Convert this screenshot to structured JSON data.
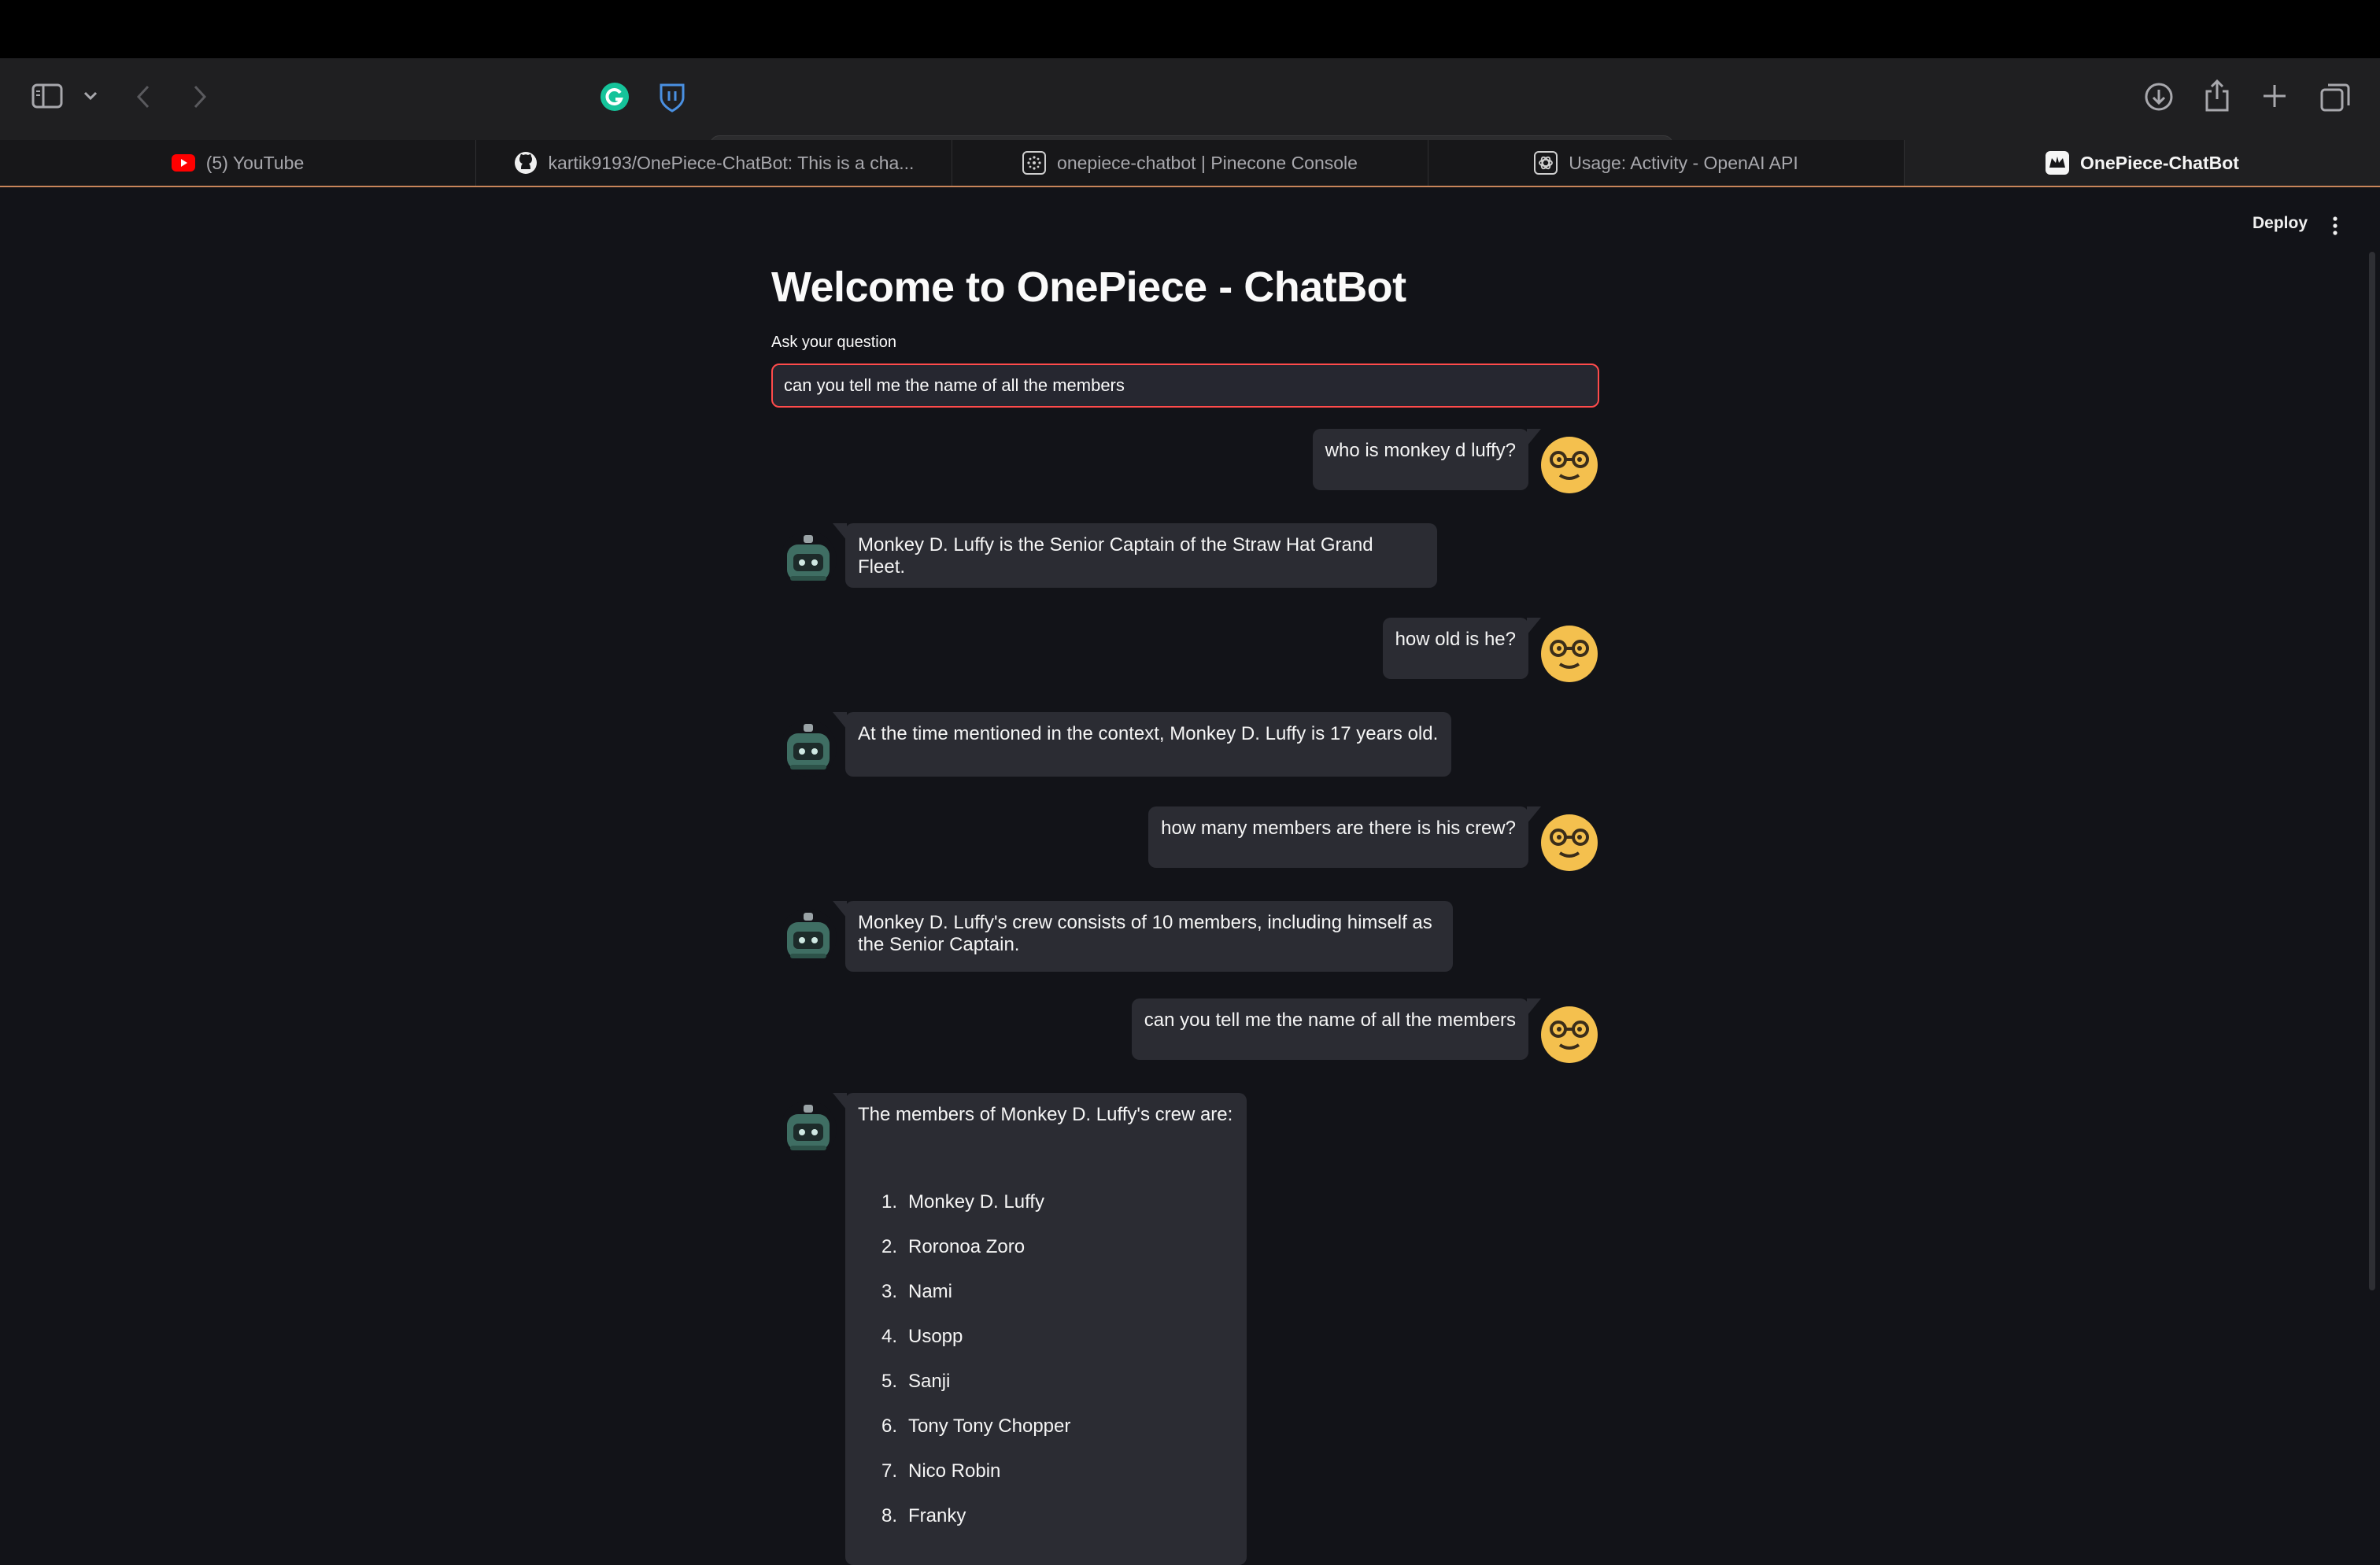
{
  "browser": {
    "url": "localhost",
    "tabs": [
      {
        "title": "(5) YouTube",
        "icon": "youtube-icon",
        "active": false
      },
      {
        "title": "kartik9193/OnePiece-ChatBot: This is a cha...",
        "icon": "github-icon",
        "active": false
      },
      {
        "title": "onepiece-chatbot | Pinecone Console",
        "icon": "pinecone-icon",
        "active": false
      },
      {
        "title": "Usage: Activity - OpenAI API",
        "icon": "openai-icon",
        "active": false
      },
      {
        "title": "OnePiece-ChatBot",
        "icon": "streamlit-icon",
        "active": true
      }
    ]
  },
  "app": {
    "deploy_label": "Deploy",
    "title": "Welcome to OnePiece - ChatBot",
    "question_label": "Ask your question",
    "question_value": "can you tell me the name of all the members"
  },
  "messages": [
    {
      "role": "user",
      "text": "who is monkey d luffy?"
    },
    {
      "role": "bot",
      "text": "Monkey D. Luffy is the Senior Captain of the Straw Hat Grand Fleet."
    },
    {
      "role": "user",
      "text": "how old is he?"
    },
    {
      "role": "bot",
      "text": "At the time mentioned in the context, Monkey D. Luffy is 17 years old."
    },
    {
      "role": "user",
      "text": "how many members are there is his crew?"
    },
    {
      "role": "bot",
      "text": "Monkey D. Luffy's crew consists of 10 members, including himself as the Senior Captain."
    },
    {
      "role": "user",
      "text": "can you tell me the name of all the members"
    },
    {
      "role": "bot",
      "text": "The members of Monkey D. Luffy's crew are:",
      "list": [
        {
          "num": "1.",
          "name": "Monkey D. Luffy"
        },
        {
          "num": "2.",
          "name": "Roronoa Zoro"
        },
        {
          "num": "3.",
          "name": "Nami"
        },
        {
          "num": "4.",
          "name": "Usopp"
        },
        {
          "num": "5.",
          "name": "Sanji"
        },
        {
          "num": "6.",
          "name": "Tony Tony Chopper"
        },
        {
          "num": "7.",
          "name": "Nico Robin"
        },
        {
          "num": "8.",
          "name": "Franky"
        }
      ]
    }
  ],
  "colors": {
    "background": "#121318",
    "bubble": "#2b2c33",
    "input_border": "#ff4b4b",
    "user_avatar": "#f4c04e",
    "bot_avatar": "#3f6e63"
  }
}
